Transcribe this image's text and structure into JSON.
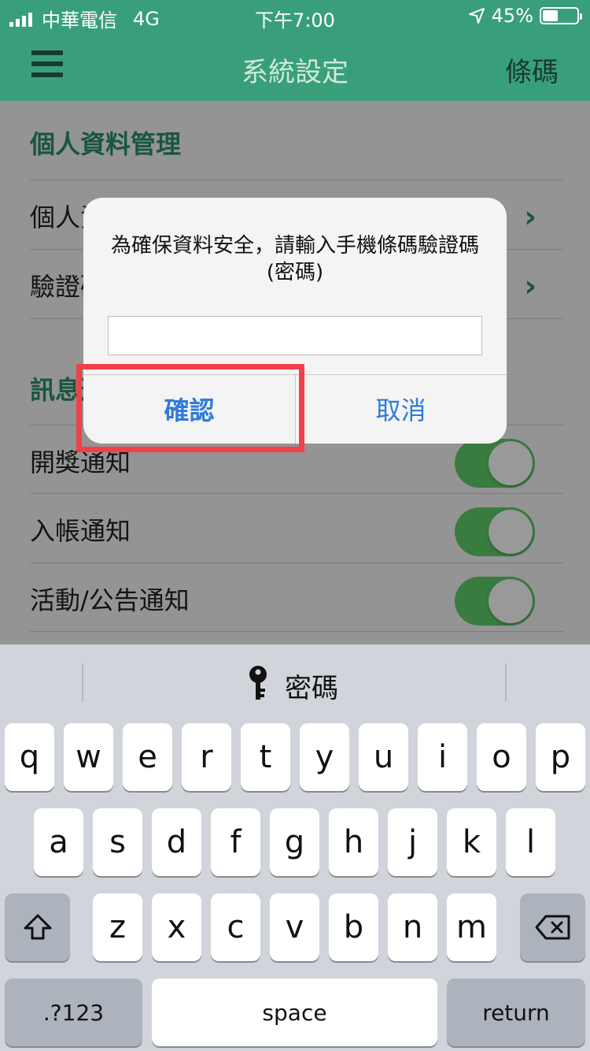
{
  "status_bar": {
    "carrier": "中華電信",
    "network": "4G",
    "time": "下午7:00",
    "battery": "45%",
    "battery_level": 0.45,
    "icons": [
      "signal-icon",
      "location-arrow-icon",
      "battery-icon"
    ]
  },
  "nav": {
    "title": "系統設定",
    "right_action": "條碼",
    "menu_icon": "hamburger-icon"
  },
  "settings": {
    "section1_title": "個人資料管理",
    "row_personal": "個人資料",
    "row_verify": "驗證碼",
    "section2_title": "訊息通知",
    "toggles": [
      {
        "label": "開獎通知",
        "on": true
      },
      {
        "label": "入帳通知",
        "on": true
      },
      {
        "label": "活動/公告通知",
        "on": true
      }
    ]
  },
  "alert": {
    "message": "為確保資料安全，請輸入手機條碼驗證碼(密碼)",
    "input_value": "",
    "confirm_label": "確認",
    "cancel_label": "取消"
  },
  "keyboard": {
    "suggestion": "密碼",
    "row1": [
      "q",
      "w",
      "e",
      "r",
      "t",
      "y",
      "u",
      "i",
      "o",
      "p"
    ],
    "row2": [
      "a",
      "s",
      "d",
      "f",
      "g",
      "h",
      "j",
      "k",
      "l"
    ],
    "row3": [
      "z",
      "x",
      "c",
      "v",
      "b",
      "n",
      "m"
    ],
    "numbers_label": ".?123",
    "space_label": "space",
    "return_label": "return"
  },
  "colors": {
    "nav_green": "#399f7a",
    "accent_green": "#2a8f6a",
    "toggle_green": "#5fcf6c",
    "ios_blue": "#2f7bd9",
    "highlight_red": "#f0404a"
  }
}
